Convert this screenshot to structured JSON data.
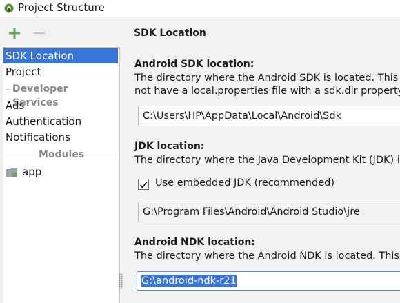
{
  "window": {
    "title": "Project Structure"
  },
  "toolbar": {
    "add_icon": "plus-icon",
    "remove_icon": "minus-icon"
  },
  "sidebar": {
    "items": [
      {
        "label": "SDK Location",
        "selected": true
      },
      {
        "label": "Project"
      }
    ],
    "groups": [
      {
        "label": "Developer Services",
        "items": [
          {
            "label": "Ads"
          },
          {
            "label": "Authentication"
          },
          {
            "label": "Notifications"
          }
        ]
      },
      {
        "label": "Modules",
        "items": [
          {
            "label": "app",
            "icon": "module-folder-icon"
          }
        ]
      }
    ]
  },
  "content": {
    "title": "SDK Location",
    "android_sdk": {
      "heading": "Android SDK location:",
      "desc_line1": "The directory where the Android SDK is located. This",
      "desc_line2": "not have a local.properties file with a sdk.dir property",
      "value": "C:\\Users\\HP\\AppData\\Local\\Android\\Sdk"
    },
    "jdk": {
      "heading": "JDK location:",
      "desc": "The directory where the Java Development Kit (JDK) i",
      "checkbox_label": "Use embedded JDK (recommended)",
      "checkbox_checked": true,
      "value": "G:\\Program Files\\Android\\Android Studio\\jre"
    },
    "ndk": {
      "heading": "Android NDK location:",
      "desc": "The directory where the Android NDK is located. This",
      "value": "G:\\android-ndk-r21"
    }
  },
  "colors": {
    "selection": "#3875d7",
    "add_green": "#4caf50",
    "focus_border": "#4d90d9"
  }
}
